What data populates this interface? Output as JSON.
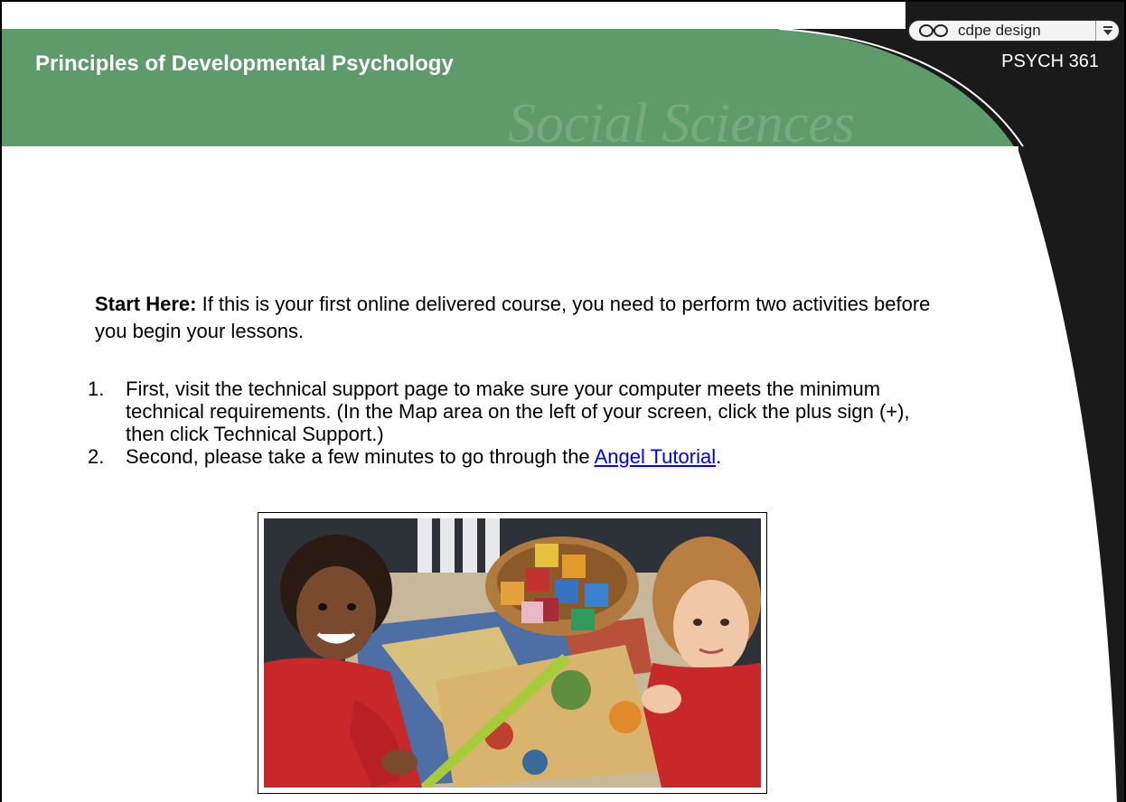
{
  "header": {
    "course_title": "Principles of Developmental Psychology",
    "course_code": "PSYCH 361",
    "watermark": "Social Sciences",
    "brand_label": "cdpe design",
    "colors": {
      "banner_green": "#5f9a6a",
      "banner_dark": "#1a1a1a"
    }
  },
  "intro": {
    "lead": "Start Here:",
    "text": " If this is your first online delivered course, you need to perform two activities before you begin your lessons."
  },
  "steps": [
    {
      "number": "1.",
      "text": "First, visit the technical support page to make sure your computer meets the minimum technical requirements. (In the Map area on the left of your screen, click the plus sign (+), then click Technical Support.)"
    },
    {
      "number": "2.",
      "text_before": "Second, please take a few minutes to go through the ",
      "link_text": "Angel Tutorial",
      "text_after": "."
    }
  ],
  "photo": {
    "icon": "children-with-blocks-photo"
  }
}
